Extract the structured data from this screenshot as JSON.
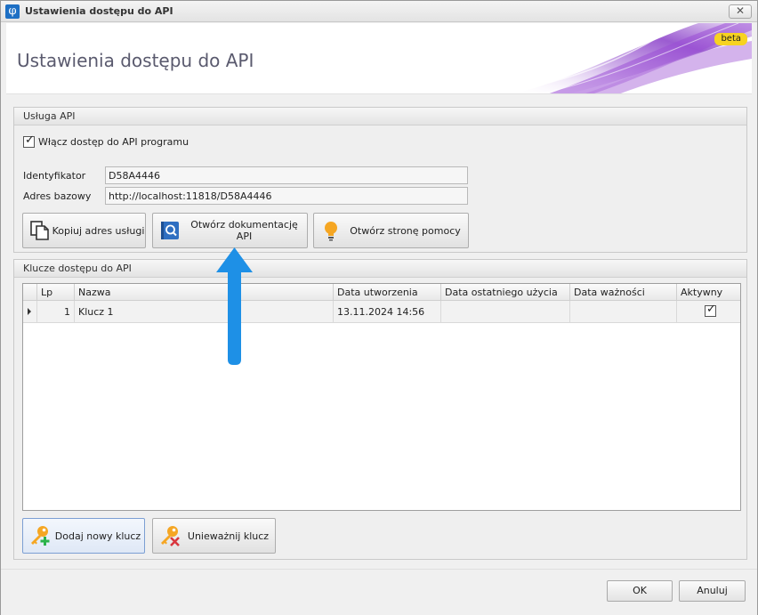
{
  "window": {
    "title": "Ustawienia dostępu do API",
    "app_icon_glyph": "φ",
    "close_glyph": "✕"
  },
  "header": {
    "title": "Ustawienia dostępu do API",
    "badge": "beta"
  },
  "service_group": {
    "title": "Usługa API",
    "enable_label": "Włącz dostęp do API programu",
    "enable_checked": true,
    "identifier_label": "Identyfikator",
    "identifier_value": "D58A4446",
    "base_address_label": "Adres bazowy",
    "base_address_value": "http://localhost:11818/D58A4446",
    "buttons": {
      "copy": "Kopiuj adres usługi",
      "docs": "Otwórz dokumentację API",
      "help": "Otwórz stronę pomocy"
    }
  },
  "keys_group": {
    "title": "Klucze dostępu do API",
    "columns": [
      "Lp",
      "Nazwa",
      "Data utworzenia",
      "Data ostatniego użycia",
      "Data ważności",
      "Aktywny"
    ],
    "rows": [
      {
        "lp": "1",
        "name": "Klucz 1",
        "created": "13.11.2024 14:56",
        "last_used": "",
        "expiry": "",
        "active": true
      }
    ],
    "buttons": {
      "add": "Dodaj nowy klucz",
      "revoke": "Unieważnij klucz"
    }
  },
  "dialog": {
    "ok": "OK",
    "cancel": "Anuluj"
  },
  "colors": {
    "accent_blue": "#1e90e6",
    "badge_yellow": "#f7d321",
    "key_orange": "#f5a623"
  }
}
